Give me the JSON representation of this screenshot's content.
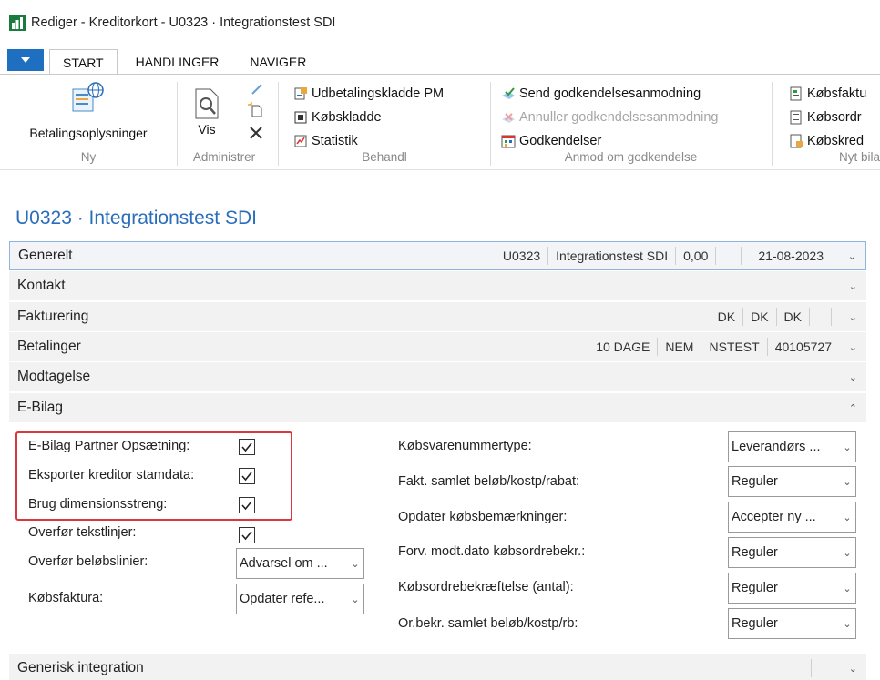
{
  "window": {
    "title": "Rediger - Kreditorkort - U0323 · Integrationstest SDI"
  },
  "tabs": [
    {
      "label": "START",
      "active": true
    },
    {
      "label": "HANDLINGER",
      "active": false
    },
    {
      "label": "NAVIGER",
      "active": false
    }
  ],
  "ribbon": {
    "ny": {
      "label": "Ny",
      "button": "Betalingsoplysninger"
    },
    "administrer": {
      "label": "Administrer",
      "button": "Vis"
    },
    "behandl": {
      "label": "Behandl",
      "items": [
        "Udbetalingskladde PM",
        "Købskladde",
        "Statistik"
      ]
    },
    "anmod": {
      "label": "Anmod om godkendelse",
      "items": [
        "Send godkendelsesanmodning",
        "Annuller godkendelsesanmodning",
        "Godkendelser"
      ]
    },
    "nyt_bilag": {
      "label": "Nyt bila",
      "items": [
        "Købsfaktu",
        "Købsordr",
        "Købskred"
      ]
    }
  },
  "page_title": "U0323 · Integrationstest SDI",
  "fasttabs": {
    "generelt": {
      "label": "Generelt",
      "summary": [
        "U0323",
        "Integrationstest SDI",
        "0,00",
        "",
        "21-08-2023"
      ]
    },
    "kontakt": {
      "label": "Kontakt"
    },
    "fakturering": {
      "label": "Fakturering",
      "summary": [
        "DK",
        "DK",
        "DK",
        ""
      ]
    },
    "betalinger": {
      "label": "Betalinger",
      "summary": [
        "10 DAGE",
        "NEM",
        "NSTEST",
        "40105727"
      ]
    },
    "modtagelse": {
      "label": "Modtagelse"
    },
    "ebilag": {
      "label": "E-Bilag"
    },
    "generisk": {
      "label": "Generisk integration"
    }
  },
  "ebilag": {
    "left": [
      {
        "label": "E-Bilag Partner Opsætning:",
        "checked": true
      },
      {
        "label": "Eksporter kreditor stamdata:",
        "checked": true
      },
      {
        "label": "Brug dimensionsstreng:",
        "checked": true
      },
      {
        "label": "Overfør tekstlinjer:",
        "checked": true
      },
      {
        "label": "Overfør beløbslinier:",
        "value": "Advarsel om ..."
      },
      {
        "label": "Købsfaktura:",
        "value": "Opdater refe..."
      }
    ],
    "right": [
      {
        "label": "Købsvarenummertype:",
        "value": "Leverandørs ..."
      },
      {
        "label": "Fakt. samlet beløb/kostp/rabat:",
        "value": "Reguler"
      },
      {
        "label": "Opdater købsbemærkninger:",
        "value": "Accepter ny ..."
      },
      {
        "label": "Forv. modt.dato købsordrebekr.:",
        "value": "Reguler"
      },
      {
        "label": "Købsordrebekræftelse (antal):",
        "value": "Reguler"
      },
      {
        "label": "Or.bekr. samlet beløb/kostp/rb:",
        "value": "Reguler"
      }
    ]
  }
}
